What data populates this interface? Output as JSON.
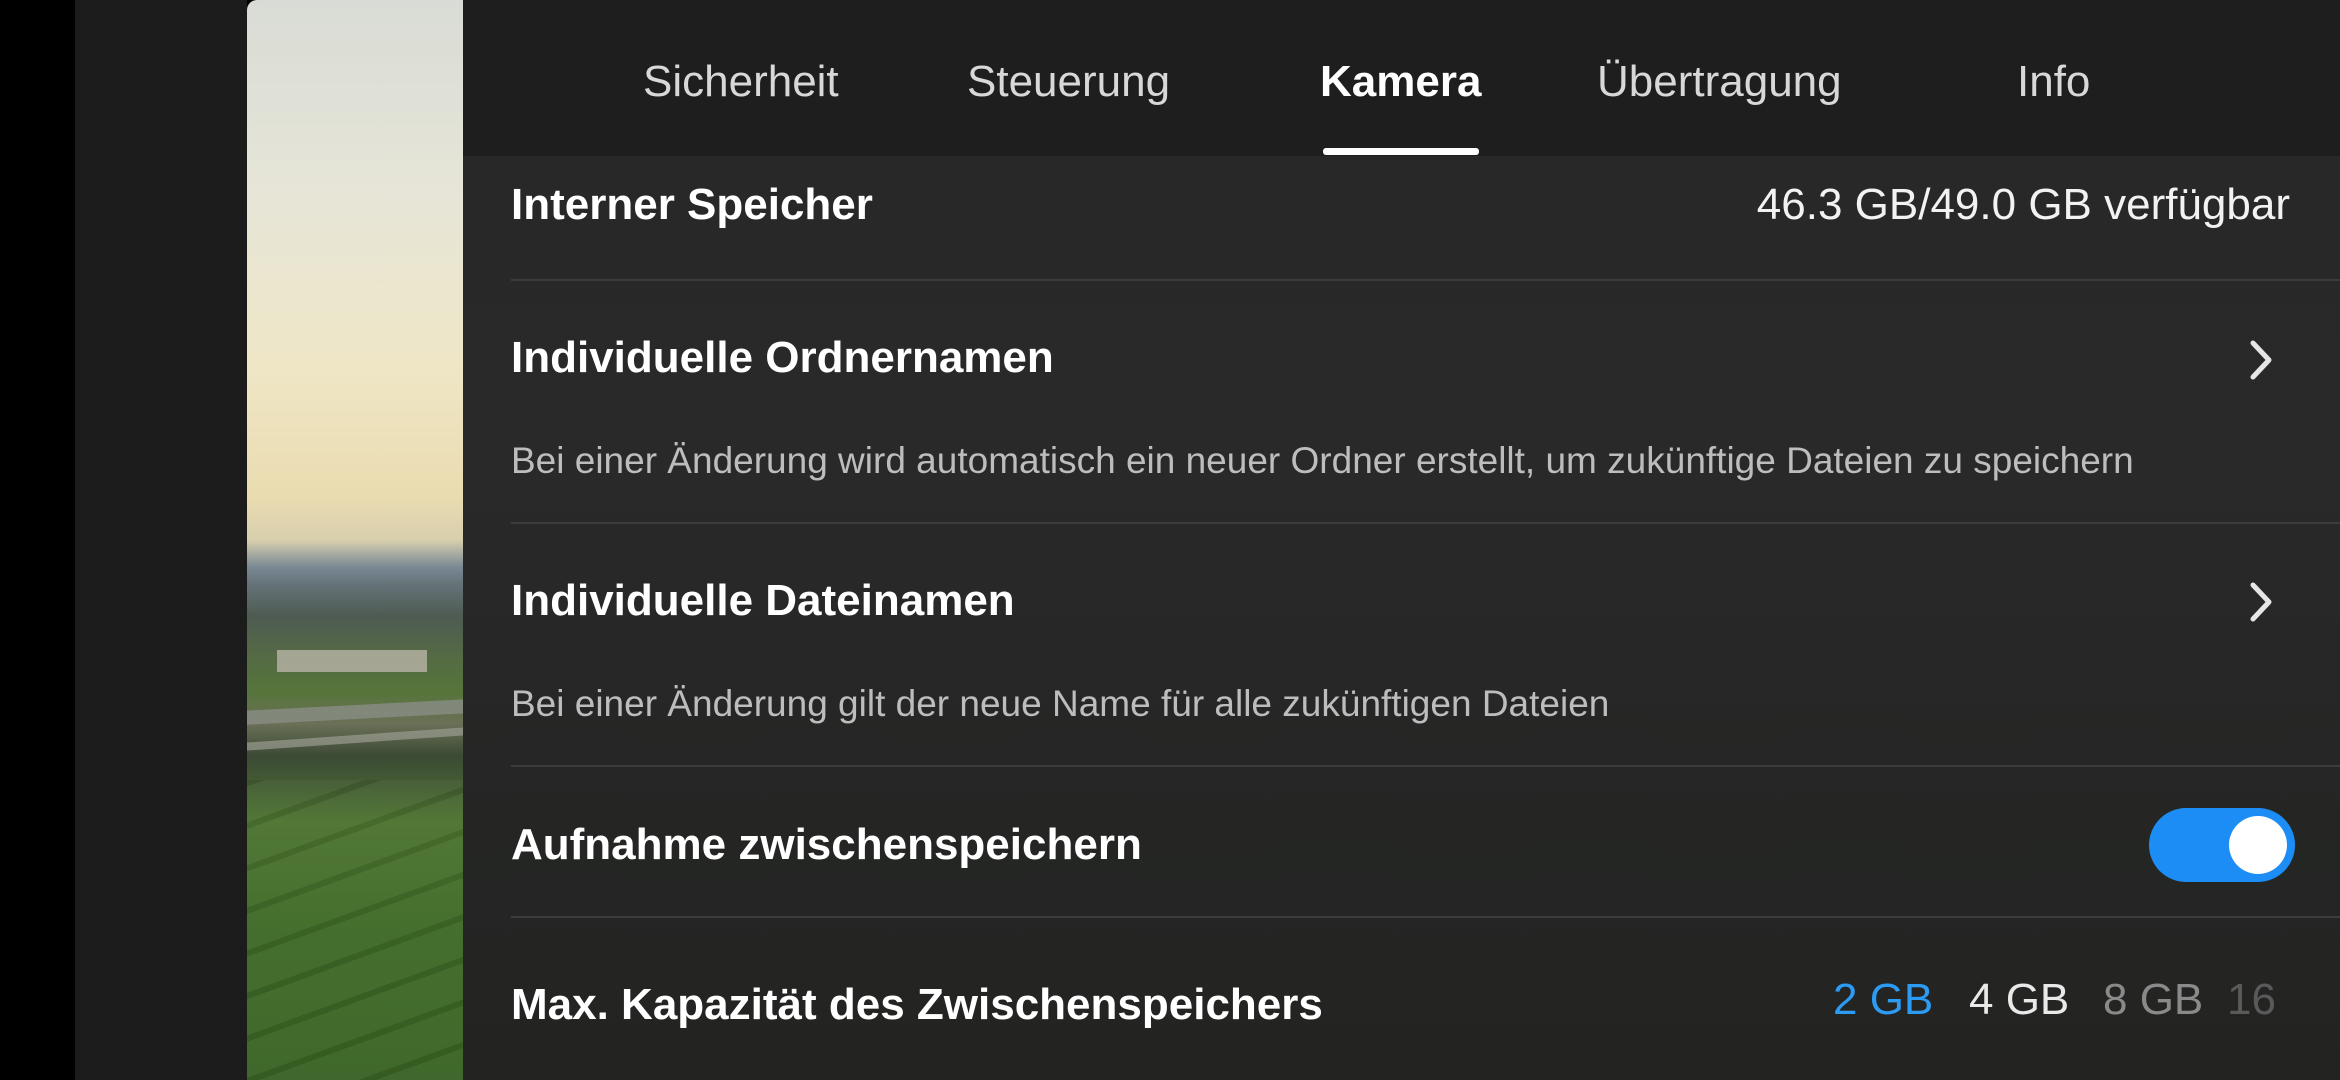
{
  "tabs": [
    {
      "label": "Sicherheit",
      "active": false
    },
    {
      "label": "Steuerung",
      "active": false
    },
    {
      "label": "Kamera",
      "active": true
    },
    {
      "label": "Übertragung",
      "active": false
    },
    {
      "label": "Info",
      "active": false
    }
  ],
  "storage": {
    "title": "Interner Speicher",
    "value": "46.3 GB/49.0 GB verfügbar"
  },
  "folder_names": {
    "title": "Individuelle Ordnernamen",
    "description": "Bei einer Änderung wird automatisch ein neuer Ordner erstellt, um zukünftige Dateien zu speichern",
    "icon": "chevron-right-icon"
  },
  "file_names": {
    "title": "Individuelle Dateinamen",
    "description": "Bei einer Änderung gilt der neue Name für alle zukünftigen Dateien",
    "icon": "chevron-right-icon"
  },
  "cache_recording": {
    "title": "Aufnahme zwischenspeichern",
    "enabled": true
  },
  "cache_capacity": {
    "title": "Max. Kapazität des Zwischenspeichers",
    "options": [
      "2 GB",
      "4 GB",
      "8 GB",
      "16"
    ],
    "selected": "2 GB"
  },
  "colors": {
    "accent": "#2c9bf3",
    "toggle_on": "#1c8df5",
    "panel_bg": "#282828"
  }
}
